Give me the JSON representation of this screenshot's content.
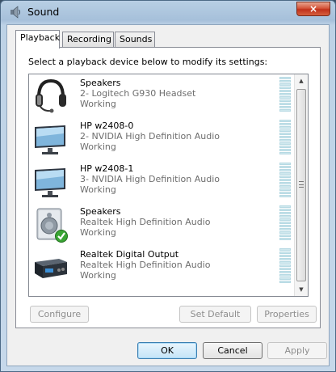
{
  "window": {
    "title": "Sound",
    "close_label": "×"
  },
  "tabs": [
    {
      "label": "Playback"
    },
    {
      "label": "Recording"
    },
    {
      "label": "Sounds"
    }
  ],
  "instruction": "Select a playback device below to modify its settings:",
  "devices": [
    {
      "name": "Speakers",
      "description": "2- Logitech G930 Headset",
      "status": "Working",
      "icon": "headset-icon"
    },
    {
      "name": "HP w2408-0",
      "description": "2- NVIDIA High Definition Audio",
      "status": "Working",
      "icon": "monitor-icon"
    },
    {
      "name": "HP w2408-1",
      "description": "3- NVIDIA High Definition Audio",
      "status": "Working",
      "icon": "monitor-icon"
    },
    {
      "name": "Speakers",
      "description": "Realtek High Definition Audio",
      "status": "Working",
      "icon": "speaker-default-icon"
    },
    {
      "name": "Realtek Digital Output",
      "description": "Realtek High Definition Audio",
      "status": "Working",
      "icon": "digital-output-icon"
    }
  ],
  "buttons": {
    "configure": "Configure",
    "set_default": "Set Default",
    "properties": "Properties",
    "ok": "OK",
    "cancel": "Cancel",
    "apply": "Apply"
  },
  "colors": {
    "default_check": "#3aa534",
    "meter": "#cfe8ee"
  }
}
